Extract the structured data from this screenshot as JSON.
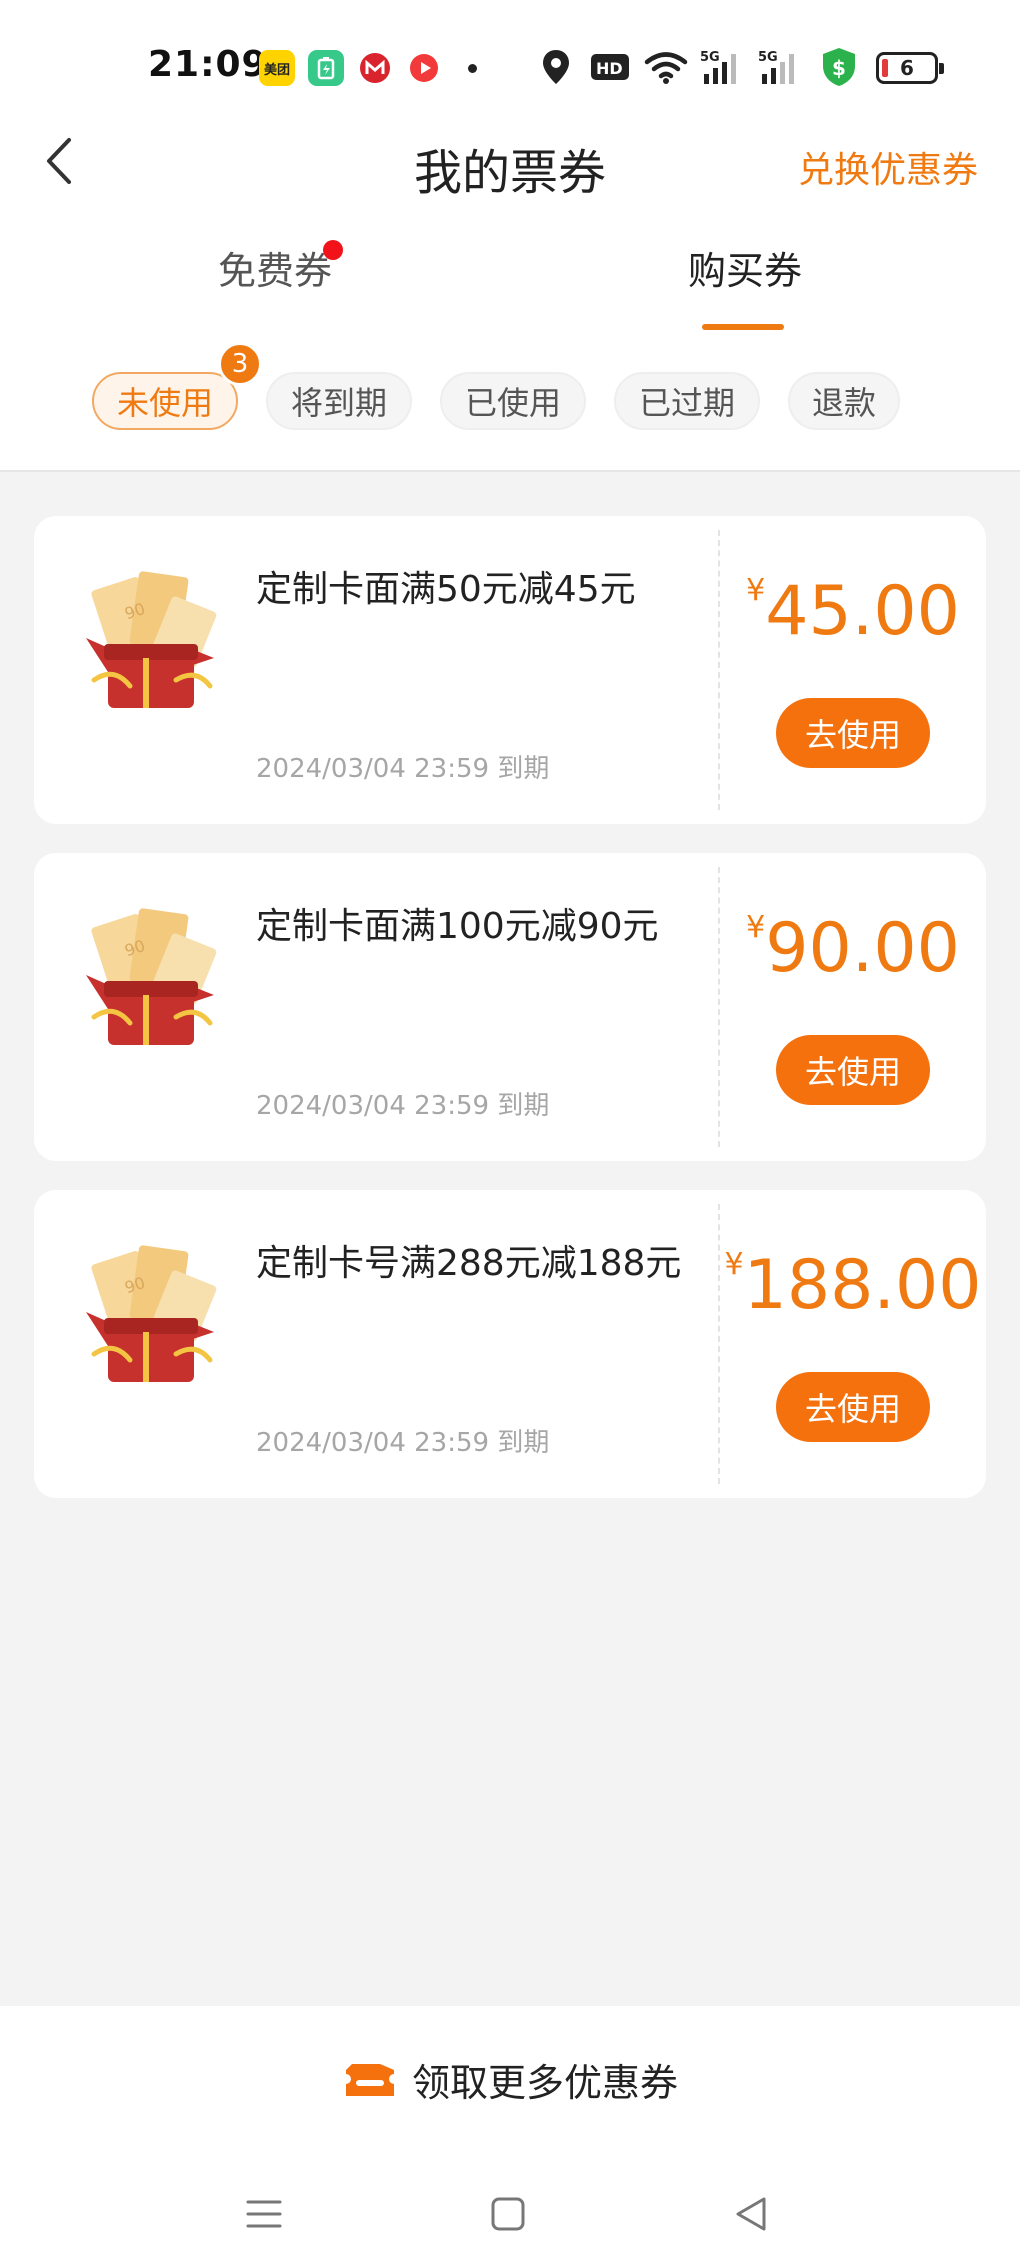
{
  "status_bar": {
    "time": "21:09",
    "apps": [
      "美团",
      "battery-app-icon",
      "bank-app-icon",
      "video-app-icon"
    ],
    "meituan_label": "美团",
    "hd_label": "HD",
    "net1": "5G",
    "net2": "5G",
    "battery_level": "6"
  },
  "nav": {
    "title": "我的票券",
    "action": "兑换优惠券"
  },
  "tabs": [
    {
      "label": "免费券",
      "has_dot": true,
      "active": false
    },
    {
      "label": "购买券",
      "has_dot": false,
      "active": true
    }
  ],
  "filters": {
    "chips": [
      "未使用",
      "将到期",
      "已使用",
      "已过期",
      "退款"
    ],
    "active_index": 0,
    "badge": "3"
  },
  "coupons": [
    {
      "title": "定制卡面满50元减45元",
      "expiry": "2024/03/04 23:59 到期",
      "currency": "¥",
      "amount": "45.00",
      "button": "去使用"
    },
    {
      "title": "定制卡面满100元减90元",
      "expiry": "2024/03/04 23:59 到期",
      "currency": "¥",
      "amount": "90.00",
      "button": "去使用"
    },
    {
      "title": "定制卡号满288元减188元",
      "expiry": "2024/03/04 23:59 到期",
      "currency": "¥",
      "amount": "188.00",
      "button": "去使用"
    }
  ],
  "bottom": {
    "more_label": "领取更多优惠券"
  },
  "colors": {
    "accent": "#f07a12",
    "button": "#f5710d",
    "dot": "#f2131a",
    "background": "#f3f3f3"
  }
}
